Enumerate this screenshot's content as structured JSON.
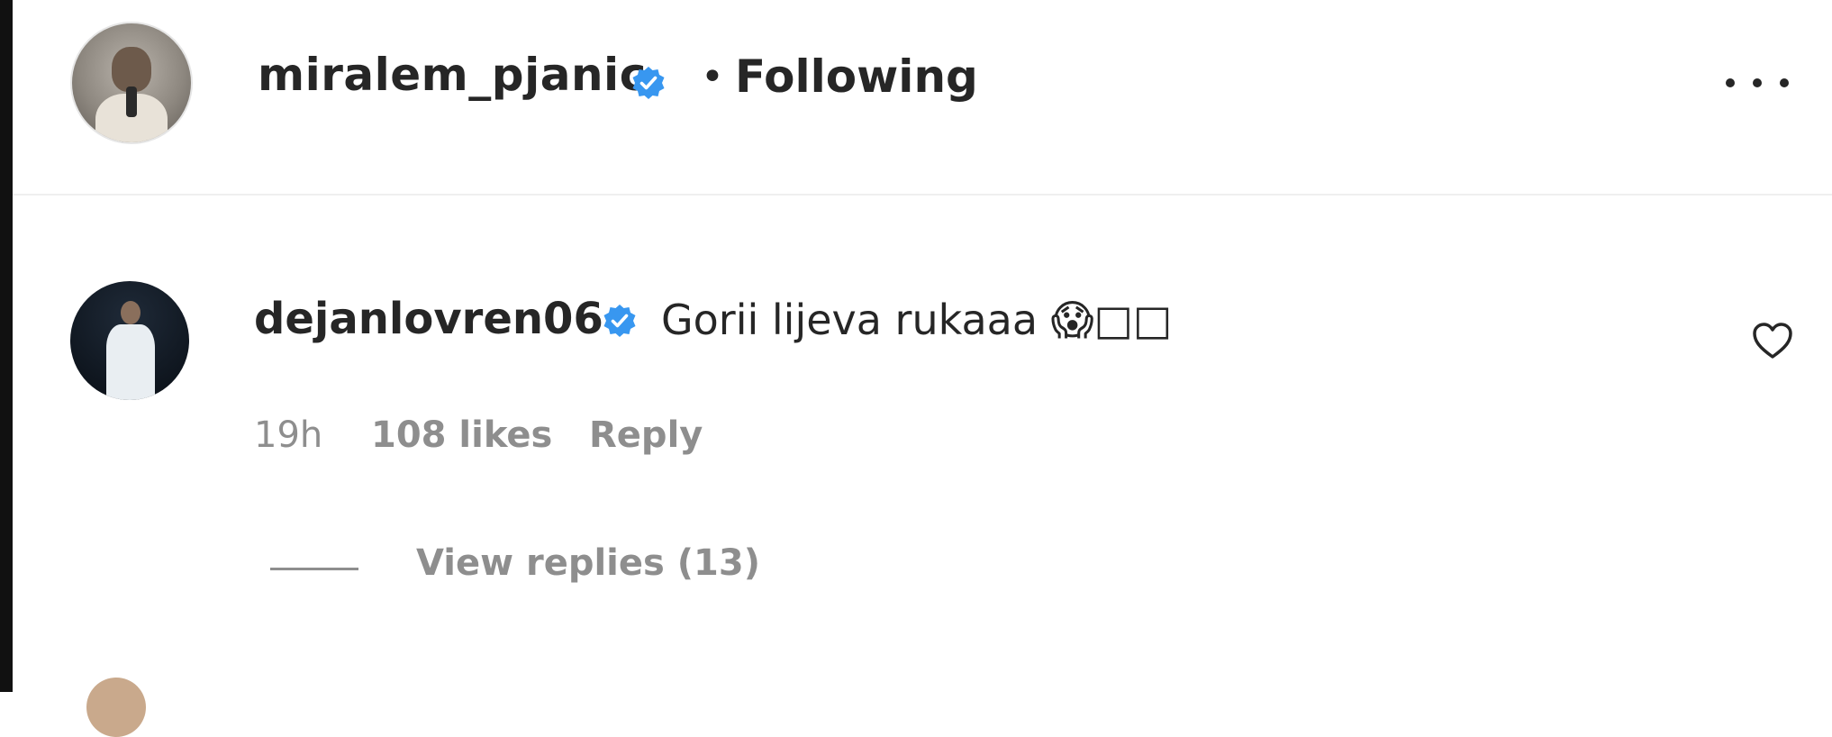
{
  "post_header": {
    "username": "miralem_pjanic",
    "separator": "•",
    "follow_status": "Following",
    "verified_icon": "verified-badge-icon",
    "more_icon": "more-options-icon"
  },
  "comment": {
    "username": "dejanlovren06",
    "text": "Gorii lijeva rukaaa 😱□□",
    "time": "19h",
    "likes": "108 likes",
    "reply_label": "Reply",
    "view_replies": "View replies (13)",
    "like_icon": "heart-outline-icon"
  },
  "colors": {
    "text": "#262626",
    "secondary_text": "#8e8e8e",
    "verified_blue": "#3897f0",
    "divider": "#efefef"
  }
}
